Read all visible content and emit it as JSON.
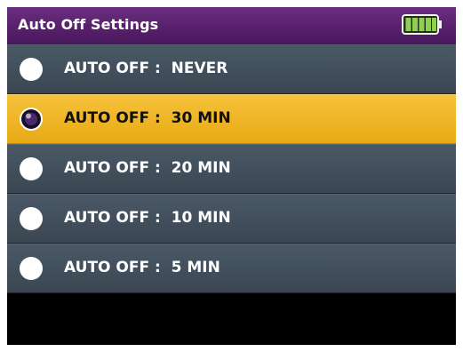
{
  "header": {
    "title": "Auto Off Settings",
    "battery_icon": "battery-full-icon",
    "battery_level": 1.0
  },
  "options": [
    {
      "label": "AUTO OFF :  NEVER",
      "selected": false
    },
    {
      "label": "AUTO OFF :  30 MIN",
      "selected": true
    },
    {
      "label": "AUTO OFF :  20 MIN",
      "selected": false
    },
    {
      "label": "AUTO OFF :  10 MIN",
      "selected": false
    },
    {
      "label": "AUTO OFF :  5 MIN",
      "selected": false
    }
  ],
  "colors": {
    "title_bar": "#58206c",
    "row": "#3f4a56",
    "selected_row": "#f0b52a",
    "battery": "#8fd14f"
  }
}
